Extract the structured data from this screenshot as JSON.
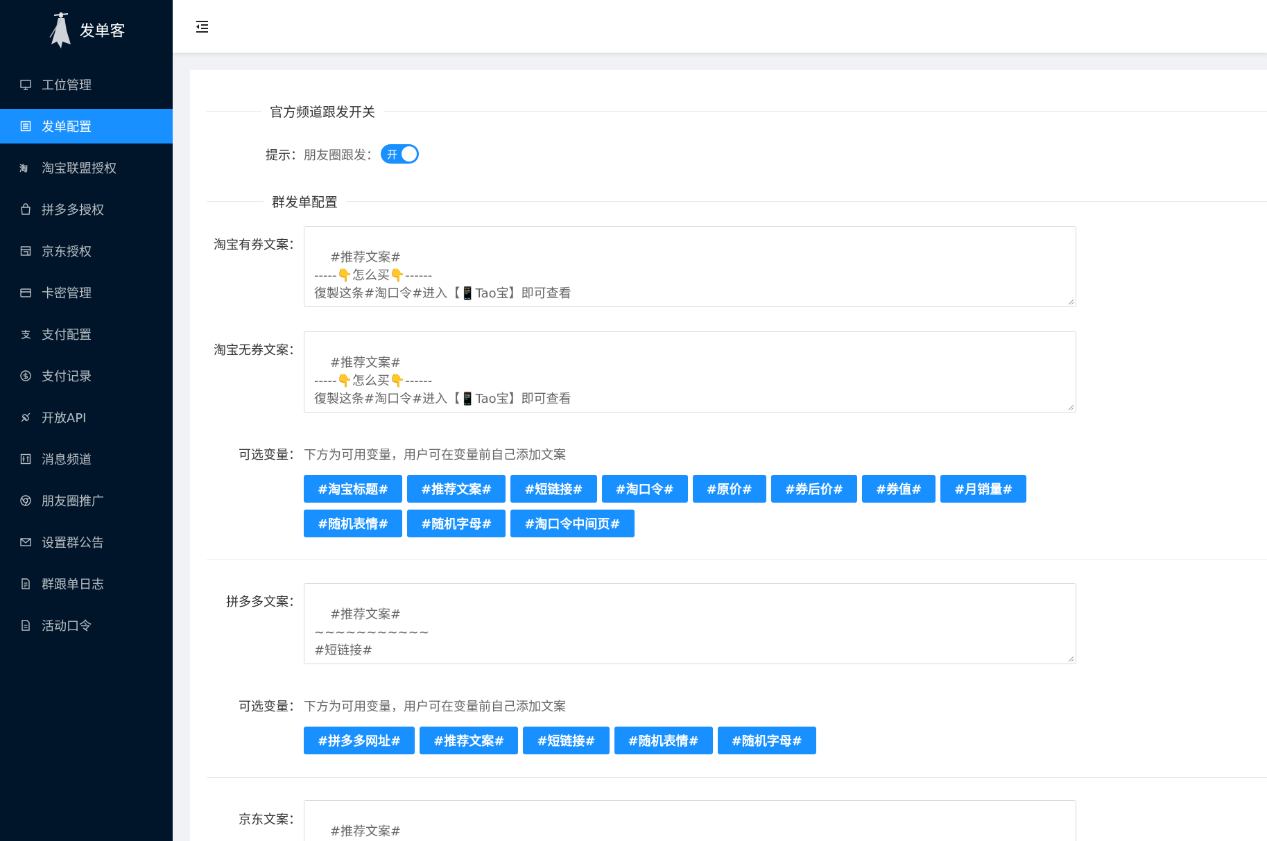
{
  "app": {
    "logo_text": "发单客"
  },
  "sidebar": {
    "items": [
      {
        "label": "工位管理",
        "icon": "monitor-icon"
      },
      {
        "label": "发单配置",
        "icon": "list-icon",
        "active": true
      },
      {
        "label": "淘宝联盟授权",
        "icon": "taobao-icon"
      },
      {
        "label": "拼多多授权",
        "icon": "shopping-bag-icon"
      },
      {
        "label": "京东授权",
        "icon": "store-icon"
      },
      {
        "label": "卡密管理",
        "icon": "card-icon"
      },
      {
        "label": "支付配置",
        "icon": "alipay-icon"
      },
      {
        "label": "支付记录",
        "icon": "dollar-icon"
      },
      {
        "label": "开放API",
        "icon": "api-icon"
      },
      {
        "label": "消息频道",
        "icon": "channel-icon"
      },
      {
        "label": "朋友圈推广",
        "icon": "chrome-icon"
      },
      {
        "label": "设置群公告",
        "icon": "mail-icon"
      },
      {
        "label": "群跟单日志",
        "icon": "file-icon"
      },
      {
        "label": "活动口令",
        "icon": "document-icon"
      }
    ]
  },
  "official": {
    "section_title": "官方频道跟发开关",
    "hint_label": "提示：",
    "moments_label": "朋友圈跟发：",
    "switch_text": "开"
  },
  "group": {
    "section_title": "群发单配置",
    "taobao_coupon": {
      "label": "淘宝有券文案：",
      "value": "#推荐文案#\n-----👇怎么买👇------\n復製这条#淘口令#进入【📱Tao宝】即可查看"
    },
    "taobao_nocoupon": {
      "label": "淘宝无券文案：",
      "value": "#推荐文案#\n-----👇怎么买👇------\n復製这条#淘口令#进入【📱Tao宝】即可查看"
    },
    "taobao_vars": {
      "label": "可选变量：",
      "desc": "下方为可用变量，用户可在变量前自己添加文案",
      "tags": [
        "#淘宝标题#",
        "#推荐文案#",
        "#短链接#",
        "#淘口令#",
        "#原价#",
        "#券后价#",
        "#券值#",
        "#月销量#",
        "#随机表情#",
        "#随机字母#",
        "#淘口令中间页#"
      ]
    },
    "pdd": {
      "label": "拼多多文案：",
      "value": "#推荐文案#\n~~~~~~~~~~~\n#短链接#"
    },
    "pdd_vars": {
      "label": "可选变量：",
      "desc": "下方为可用变量，用户可在变量前自己添加文案",
      "tags": [
        "#拼多多网址#",
        "#推荐文案#",
        "#短链接#",
        "#随机表情#",
        "#随机字母#"
      ]
    },
    "jd": {
      "label": "京东文案：",
      "value": "#推荐文案#\n~~~~~~~~~~~"
    }
  }
}
